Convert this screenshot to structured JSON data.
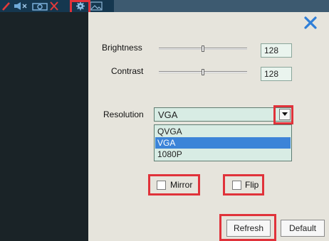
{
  "toolbar": {
    "icons": [
      "pencil-icon",
      "speaker-icon",
      "camera-icon",
      "close-icon",
      "gear-icon",
      "picture-icon"
    ]
  },
  "dialog": {
    "close_icon": "close-icon",
    "brightness": {
      "label": "Brightness",
      "value": "128",
      "level": 0.5
    },
    "contrast": {
      "label": "Contrast",
      "value": "128",
      "level": 0.5
    },
    "resolution": {
      "label": "Resolution",
      "selected": "VGA",
      "options": [
        "QVGA",
        "VGA",
        "1080P"
      ],
      "highlighted_option": "VGA"
    },
    "mirror": {
      "label": "Mirror",
      "checked": false
    },
    "flip": {
      "label": "Flip",
      "checked": false
    },
    "refresh_label": "Refresh",
    "default_label": "Default"
  },
  "colors": {
    "highlight": "#e0323a",
    "accent": "#2f7fd8",
    "panel": "#e6e4dc",
    "video_area": "#1a2327"
  }
}
